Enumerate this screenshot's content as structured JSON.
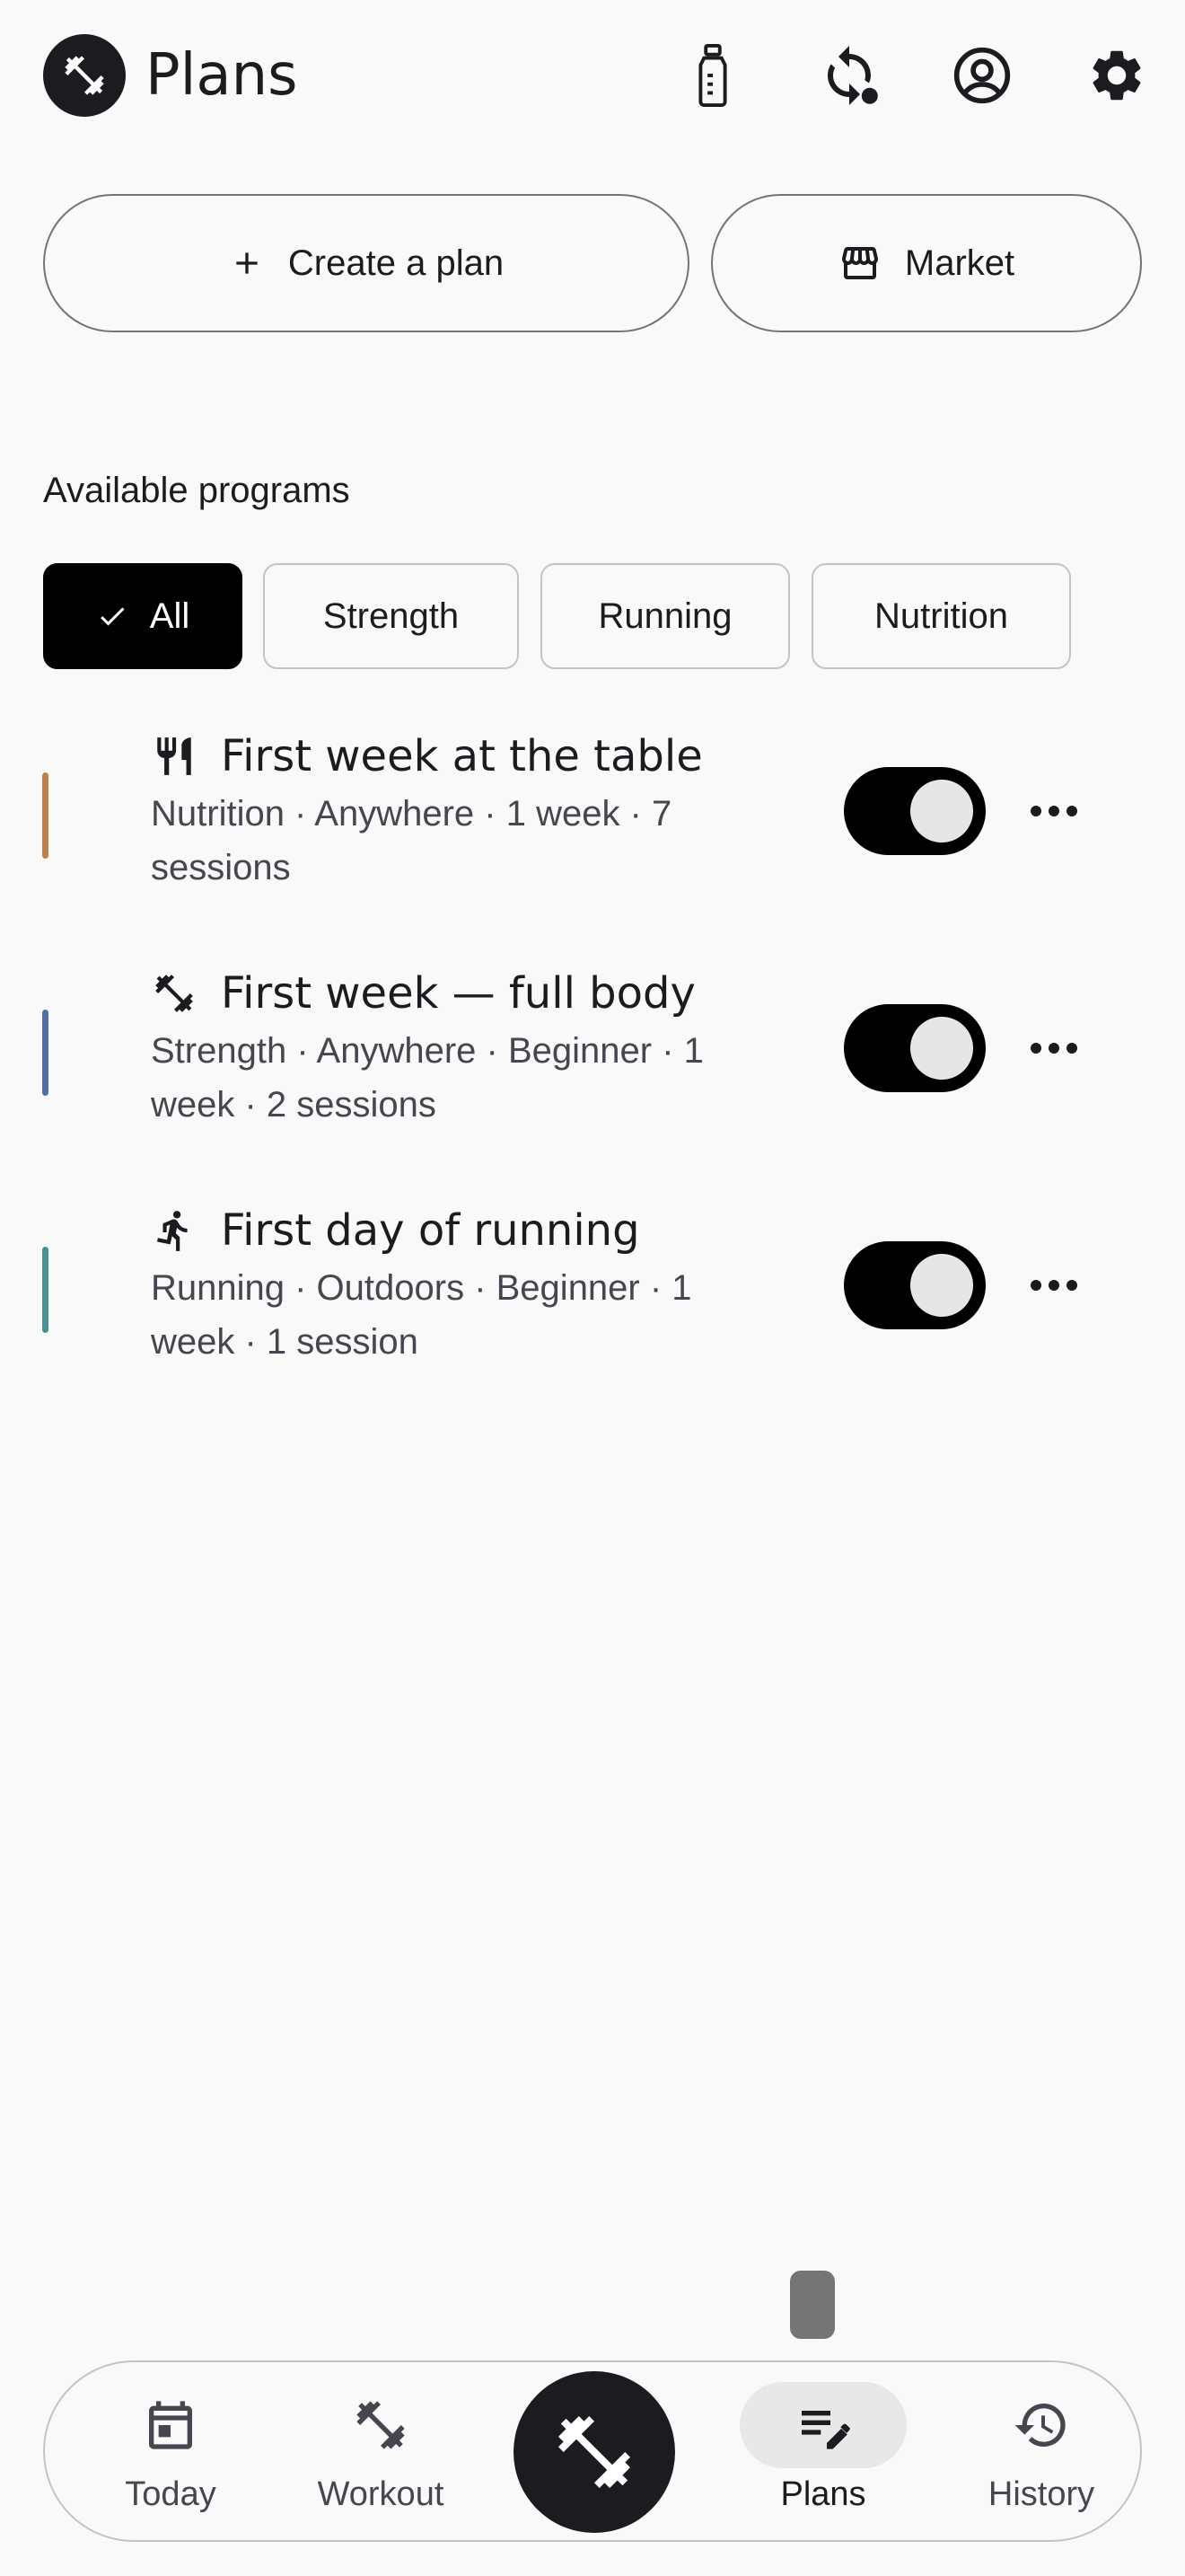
{
  "header": {
    "title": "Plans",
    "logo_icon": "dumbbell-icon",
    "actions": [
      {
        "name": "water-bottle-icon"
      },
      {
        "name": "sync-icon"
      },
      {
        "name": "account-icon"
      },
      {
        "name": "settings-icon"
      }
    ]
  },
  "actions": {
    "create_label": "Create a plan",
    "market_label": "Market"
  },
  "programs": {
    "section_label": "Available programs",
    "filters": [
      {
        "label": "All",
        "selected": true
      },
      {
        "label": "Strength",
        "selected": false
      },
      {
        "label": "Running",
        "selected": false
      },
      {
        "label": "Nutrition",
        "selected": false
      }
    ],
    "items": [
      {
        "title": "First week at the table",
        "meta": "Nutrition · Anywhere · 1 week · 7 sessions",
        "icon": "fork-knife-icon",
        "accent": "#c47f42",
        "enabled": true
      },
      {
        "title": "First week — full body",
        "meta": "Strength · Anywhere · Beginner · 1 week · 2 sessions",
        "icon": "dumbbell-icon",
        "accent": "#4e6fae",
        "enabled": true
      },
      {
        "title": "First day of running",
        "meta": "Running · Outdoors · Beginner · 1 week · 1 session",
        "icon": "running-icon",
        "accent": "#3f9692",
        "enabled": true
      }
    ]
  },
  "nav": {
    "items": [
      {
        "label": "Today",
        "icon": "calendar-icon",
        "active": false
      },
      {
        "label": "Workout",
        "icon": "dumbbell-icon",
        "active": false
      },
      {
        "label": "Plans",
        "icon": "edit-list-icon",
        "active": true
      },
      {
        "label": "History",
        "icon": "history-icon",
        "active": false
      }
    ],
    "fab_icon": "dumbbell-icon"
  },
  "colors": {
    "background": "#f9f9f9",
    "primary": "#000000",
    "outline": "#757575",
    "nutrition_accent": "#c47f42",
    "strength_accent": "#4e6fae",
    "running_accent": "#3f9692"
  }
}
